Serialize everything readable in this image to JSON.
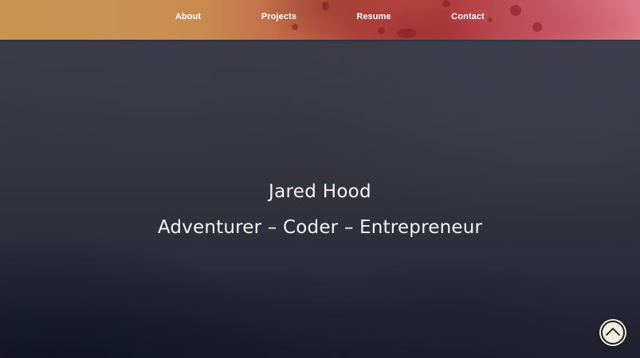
{
  "nav": {
    "items": [
      {
        "label": "About"
      },
      {
        "label": "Projects"
      },
      {
        "label": "Resume"
      },
      {
        "label": "Contact"
      }
    ]
  },
  "hero": {
    "title": "Jared Hood",
    "subtitle": "Adventurer – Coder – Entrepreneur"
  },
  "scroll_top": {
    "icon": "chevron-up-icon"
  },
  "colors": {
    "header_left": "#c9944f",
    "header_right": "#d97b86",
    "hero_bg": "#2b2d3a",
    "text": "#f3f3f3"
  }
}
